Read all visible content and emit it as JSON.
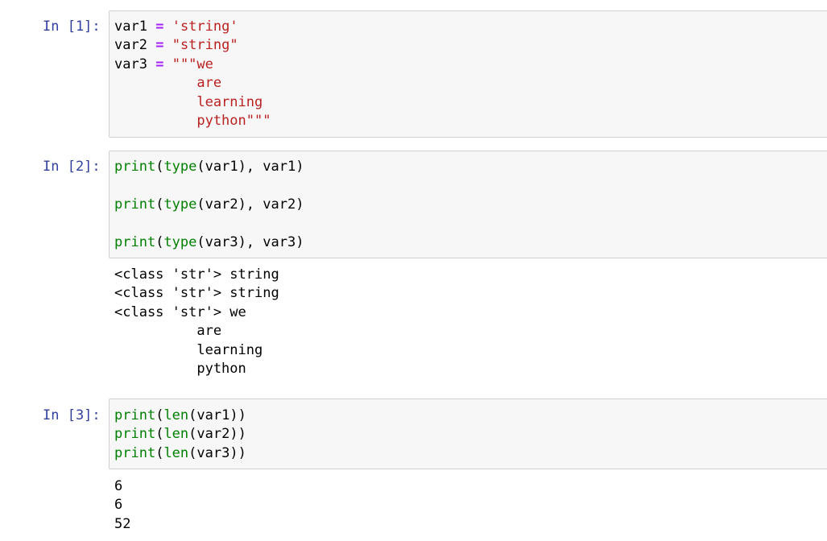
{
  "cells": [
    {
      "prompt": "In [1]:",
      "lines": [
        [
          {
            "t": "var1",
            "k": "var"
          },
          {
            "t": " ",
            "k": "var"
          },
          {
            "t": "=",
            "k": "op"
          },
          {
            "t": " ",
            "k": "var"
          },
          {
            "t": "'string'",
            "k": "str"
          }
        ],
        [
          {
            "t": "var2",
            "k": "var"
          },
          {
            "t": " ",
            "k": "var"
          },
          {
            "t": "=",
            "k": "op"
          },
          {
            "t": " ",
            "k": "var"
          },
          {
            "t": "\"string\"",
            "k": "str"
          }
        ],
        [
          {
            "t": "var3",
            "k": "var"
          },
          {
            "t": " ",
            "k": "var"
          },
          {
            "t": "=",
            "k": "op"
          },
          {
            "t": " ",
            "k": "var"
          },
          {
            "t": "\"\"\"we",
            "k": "str"
          }
        ],
        [
          {
            "t": "          are",
            "k": "str"
          }
        ],
        [
          {
            "t": "          learning",
            "k": "str"
          }
        ],
        [
          {
            "t": "          python\"\"\"",
            "k": "str"
          }
        ]
      ],
      "output": []
    },
    {
      "prompt": "In [2]:",
      "lines": [
        [
          {
            "t": "print",
            "k": "fn"
          },
          {
            "t": "(",
            "k": "punct"
          },
          {
            "t": "type",
            "k": "fn"
          },
          {
            "t": "(var1), var1)",
            "k": "punct"
          }
        ],
        [
          {
            "t": "",
            "k": "var"
          }
        ],
        [
          {
            "t": "print",
            "k": "fn"
          },
          {
            "t": "(",
            "k": "punct"
          },
          {
            "t": "type",
            "k": "fn"
          },
          {
            "t": "(var2), var2)",
            "k": "punct"
          }
        ],
        [
          {
            "t": "",
            "k": "var"
          }
        ],
        [
          {
            "t": "print",
            "k": "fn"
          },
          {
            "t": "(",
            "k": "punct"
          },
          {
            "t": "type",
            "k": "fn"
          },
          {
            "t": "(var3), var3)",
            "k": "punct"
          }
        ]
      ],
      "output": [
        "<class 'str'> string",
        "<class 'str'> string",
        "<class 'str'> we",
        "          are",
        "          learning",
        "          python"
      ]
    },
    {
      "prompt": "In [3]:",
      "lines": [
        [
          {
            "t": "print",
            "k": "fn"
          },
          {
            "t": "(",
            "k": "punct"
          },
          {
            "t": "len",
            "k": "fn"
          },
          {
            "t": "(var1))",
            "k": "punct"
          }
        ],
        [
          {
            "t": "print",
            "k": "fn"
          },
          {
            "t": "(",
            "k": "punct"
          },
          {
            "t": "len",
            "k": "fn"
          },
          {
            "t": "(var2))",
            "k": "punct"
          }
        ],
        [
          {
            "t": "print",
            "k": "fn"
          },
          {
            "t": "(",
            "k": "punct"
          },
          {
            "t": "len",
            "k": "fn"
          },
          {
            "t": "(var3))",
            "k": "punct"
          }
        ]
      ],
      "output": [
        "6",
        "6",
        "52"
      ]
    }
  ],
  "colors": {
    "prompt": "#303f9f",
    "input_bg": "#f7f7f7",
    "input_border": "#cfcfcf",
    "string": "#ba2121",
    "builtin": "#008000",
    "operator": "#aa22ff"
  }
}
